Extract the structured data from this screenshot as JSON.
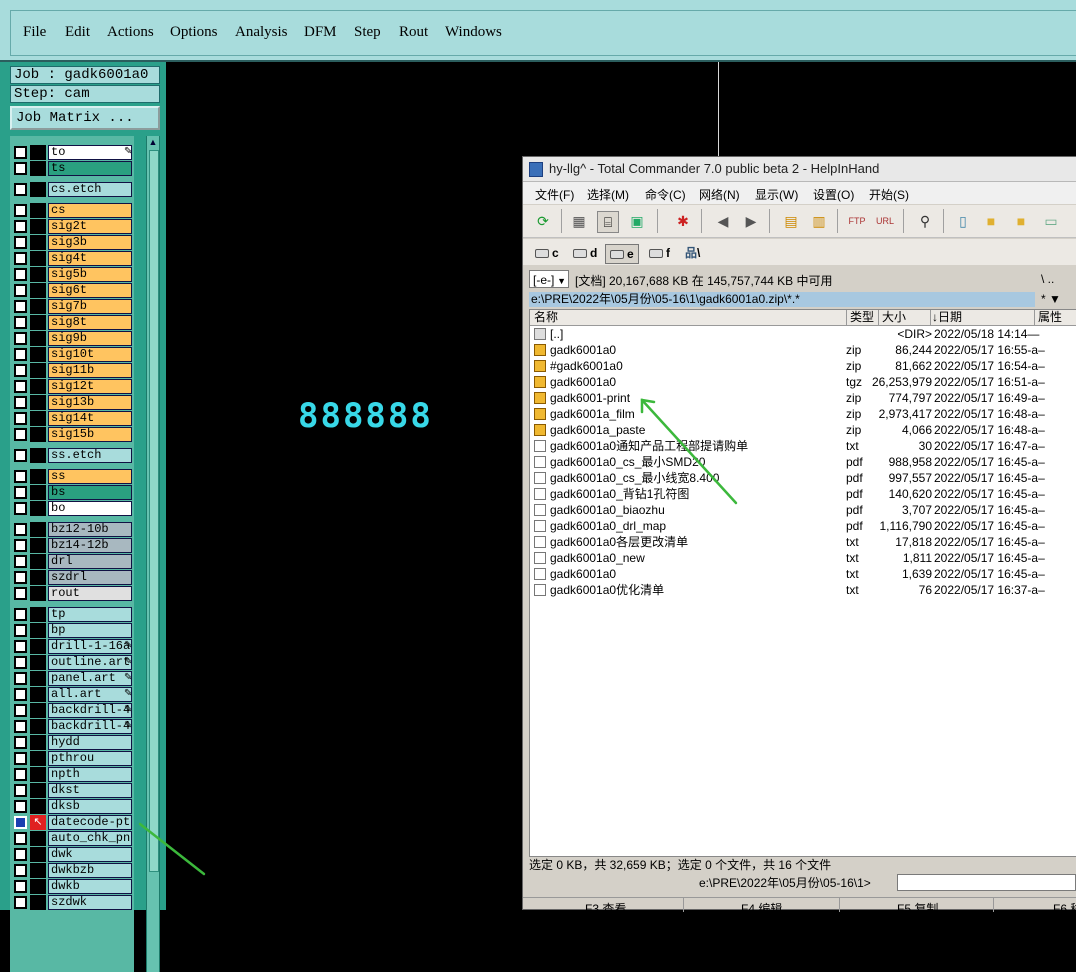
{
  "menubar": {
    "items": [
      "File",
      "Edit",
      "Actions",
      "Options",
      "Analysis",
      "DFM",
      "Step",
      "Rout",
      "Windows"
    ]
  },
  "job": {
    "job_label": "Job : gadk6001a0",
    "step_label": "Step: cam",
    "matrix_button": "Job Matrix ..."
  },
  "layers": [
    {
      "name": "to",
      "color": "white",
      "editable": true
    },
    {
      "name": "ts",
      "color": "green"
    },
    {
      "name": "cs.etch",
      "color": "cyan"
    },
    {
      "name": "cs",
      "color": "orange"
    },
    {
      "name": "sig2t",
      "color": "orange"
    },
    {
      "name": "sig3b",
      "color": "orange"
    },
    {
      "name": "sig4t",
      "color": "orange"
    },
    {
      "name": "sig5b",
      "color": "orange"
    },
    {
      "name": "sig6t",
      "color": "orange"
    },
    {
      "name": "sig7b",
      "color": "orange"
    },
    {
      "name": "sig8t",
      "color": "orange"
    },
    {
      "name": "sig9b",
      "color": "orange"
    },
    {
      "name": "sig10t",
      "color": "orange"
    },
    {
      "name": "sig11b",
      "color": "orange"
    },
    {
      "name": "sig12t",
      "color": "orange"
    },
    {
      "name": "sig13b",
      "color": "orange"
    },
    {
      "name": "sig14t",
      "color": "orange"
    },
    {
      "name": "sig15b",
      "color": "orange"
    },
    {
      "name": "ss.etch",
      "color": "cyan"
    },
    {
      "name": "ss",
      "color": "orange"
    },
    {
      "name": "bs",
      "color": "green"
    },
    {
      "name": "bo",
      "color": "white"
    },
    {
      "name": "bz12-10b",
      "color": "gray"
    },
    {
      "name": "bz14-12b",
      "color": "gray"
    },
    {
      "name": "drl",
      "color": "gray"
    },
    {
      "name": "szdrl",
      "color": "gray"
    },
    {
      "name": "rout",
      "color": "ltgray"
    },
    {
      "name": "tp",
      "color": "cyan"
    },
    {
      "name": "bp",
      "color": "cyan"
    },
    {
      "name": "drill-1-16a",
      "color": "cyan",
      "editable": true
    },
    {
      "name": "outline.art",
      "color": "cyan",
      "editable": true
    },
    {
      "name": "panel.art",
      "color": "cyan",
      "editable": true
    },
    {
      "name": "all.art",
      "color": "cyan",
      "editable": true
    },
    {
      "name": "backdrill-4",
      "color": "cyan",
      "editable": true
    },
    {
      "name": "backdrill-4",
      "color": "cyan",
      "editable": true
    },
    {
      "name": "hydd",
      "color": "cyan"
    },
    {
      "name": "pthrou",
      "color": "cyan"
    },
    {
      "name": "npth",
      "color": "cyan"
    },
    {
      "name": "dkst",
      "color": "cyan"
    },
    {
      "name": "dksb",
      "color": "cyan"
    },
    {
      "name": "datecode-pt",
      "color": "cyan",
      "selected": true
    },
    {
      "name": "auto_chk_pn",
      "color": "cyan"
    },
    {
      "name": "dwk",
      "color": "cyan"
    },
    {
      "name": "dwkbzb",
      "color": "cyan"
    },
    {
      "name": "dwkb",
      "color": "cyan"
    },
    {
      "name": "szdwk",
      "color": "cyan"
    }
  ],
  "display_number": "888888",
  "tc": {
    "title": "hy-llg^ - Total Commander 7.0 public beta 2 - HelpInHand",
    "menu": [
      "文件(F)",
      "选择(M)",
      "命令(C)",
      "网络(N)",
      "显示(W)",
      "设置(O)",
      "开始(S)"
    ],
    "drives": [
      "c",
      "d",
      "e",
      "f",
      "\\"
    ],
    "active_drive": "e",
    "drive_select": "[-e-]",
    "disk_info": "[文档]  20,167,688 KB 在 145,757,744 KB 中可用",
    "side_buttons": "\\  ..",
    "path": "e:\\PRE\\2022年\\05月份\\05-16\\1\\gadk6001a0.zip\\*.*",
    "path_buttons": "*  ▼",
    "columns": {
      "name": "名称",
      "type": "类型",
      "size": "大小",
      "date": "↓日期",
      "attr": "属性"
    },
    "files": [
      {
        "name": "[..]",
        "type": "",
        "size": "<DIR>",
        "date": "2022/05/18 14:14—",
        "icon": "up"
      },
      {
        "name": "gadk6001a0",
        "type": "zip",
        "size": "86,244",
        "date": "2022/05/17 16:55-a–",
        "icon": "zip"
      },
      {
        "name": "#gadk6001a0",
        "type": "zip",
        "size": "81,662",
        "date": "2022/05/17 16:54-a–",
        "icon": "zip"
      },
      {
        "name": "gadk6001a0",
        "type": "tgz",
        "size": "26,253,979",
        "date": "2022/05/17 16:51-a–",
        "icon": "zip"
      },
      {
        "name": "gadk6001-print",
        "type": "zip",
        "size": "774,797",
        "date": "2022/05/17 16:49-a–",
        "icon": "zip"
      },
      {
        "name": "gadk6001a_film",
        "type": "zip",
        "size": "2,973,417",
        "date": "2022/05/17 16:48-a–",
        "icon": "zip"
      },
      {
        "name": "gadk6001a_paste",
        "type": "zip",
        "size": "4,066",
        "date": "2022/05/17 16:48-a–",
        "icon": "zip"
      },
      {
        "name": "gadk6001a0通知产品工程部提请购单",
        "type": "txt",
        "size": "30",
        "date": "2022/05/17 16:47-a–",
        "icon": "doc"
      },
      {
        "name": "gadk6001a0_cs_最小SMD20",
        "type": "pdf",
        "size": "988,958",
        "date": "2022/05/17 16:45-a–",
        "icon": "doc"
      },
      {
        "name": "gadk6001a0_cs_最小线宽8.400",
        "type": "pdf",
        "size": "997,557",
        "date": "2022/05/17 16:45-a–",
        "icon": "doc"
      },
      {
        "name": "gadk6001a0_背钻1孔符图",
        "type": "pdf",
        "size": "140,620",
        "date": "2022/05/17 16:45-a–",
        "icon": "doc"
      },
      {
        "name": "gadk6001a0_biaozhu",
        "type": "pdf",
        "size": "3,707",
        "date": "2022/05/17 16:45-a–",
        "icon": "doc"
      },
      {
        "name": "gadk6001a0_drl_map",
        "type": "pdf",
        "size": "1,116,790",
        "date": "2022/05/17 16:45-a–",
        "icon": "doc"
      },
      {
        "name": "gadk6001a0各层更改清单",
        "type": "txt",
        "size": "17,818",
        "date": "2022/05/17 16:45-a–",
        "icon": "doc"
      },
      {
        "name": "gadk6001a0_new",
        "type": "txt",
        "size": "1,811",
        "date": "2022/05/17 16:45-a–",
        "icon": "doc"
      },
      {
        "name": "gadk6001a0",
        "type": "txt",
        "size": "1,639",
        "date": "2022/05/17 16:45-a–",
        "icon": "doc"
      },
      {
        "name": "gadk6001a0优化清单",
        "type": "txt",
        "size": "76",
        "date": "2022/05/17 16:37-a–",
        "icon": "doc"
      }
    ],
    "status": "选定 0 KB，共 32,659 KB；选定 0 个文件，共 16 个文件",
    "cmd_path": "e:\\PRE\\2022年\\05月份\\05-16\\1>",
    "fkeys": [
      "F3 查看",
      "F4 编辑",
      "F5 复制",
      "F6 移"
    ]
  },
  "colors": {
    "menubar_bg": "#a8dcdc",
    "panel_bg": "#2aa08a",
    "annotation_arrow": "#3cb83c"
  }
}
